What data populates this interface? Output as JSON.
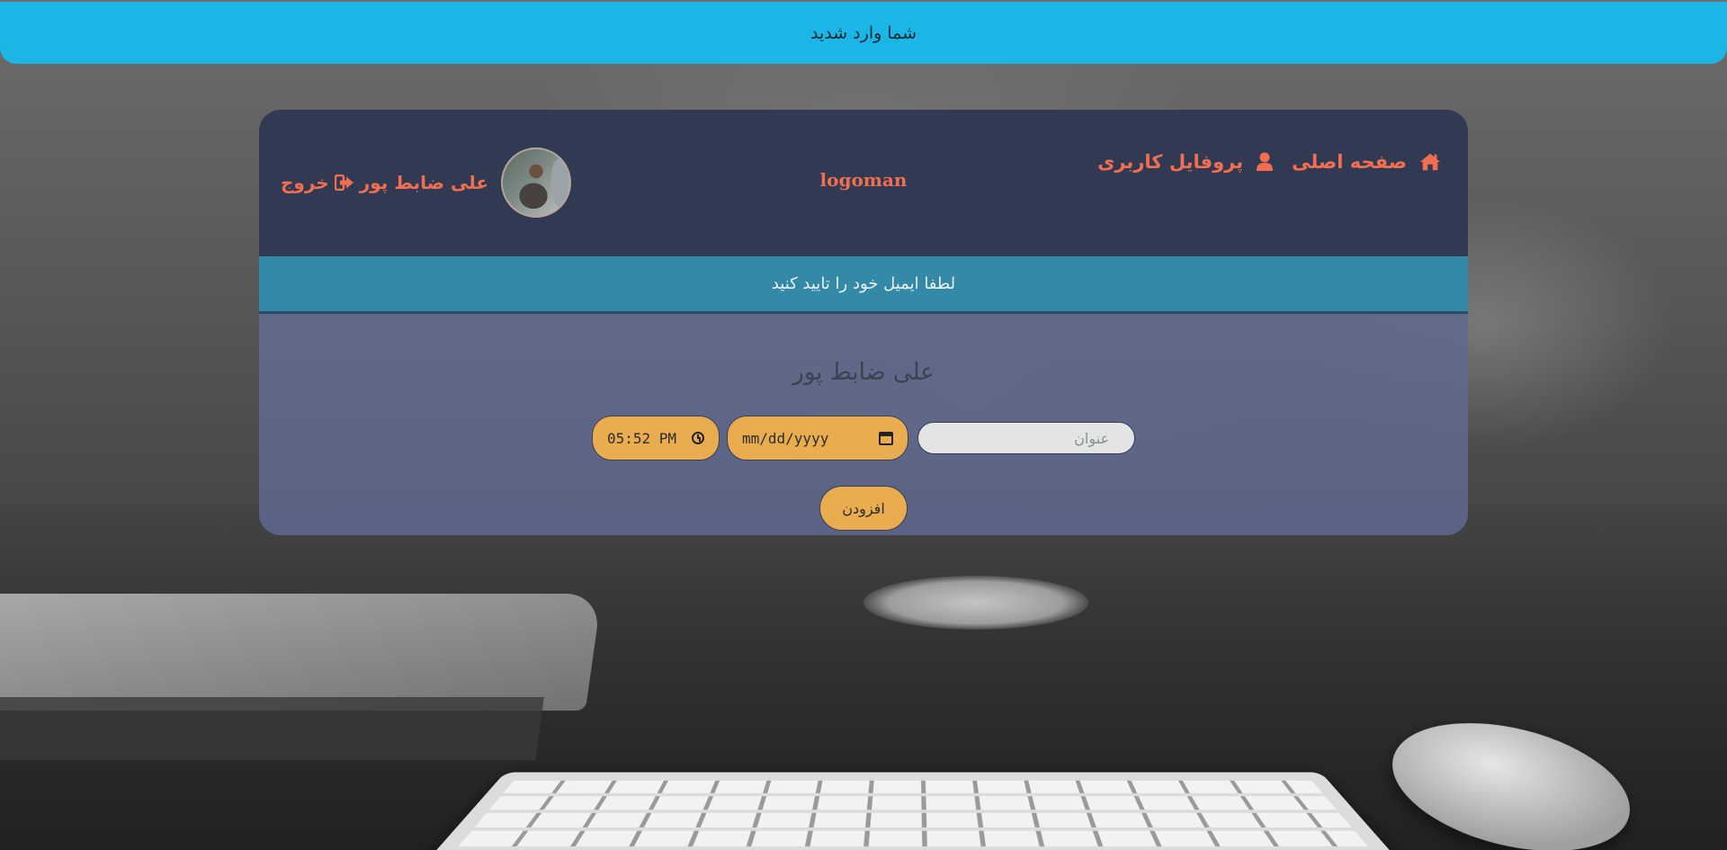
{
  "notification": {
    "text": "شما وارد شدید"
  },
  "navbar": {
    "user_name": "علی ضابط پور",
    "logout_label": "خروج",
    "logo_text": "logoman",
    "profile_label": "پروفایل کاربری",
    "home_label": "صفحه اصلی",
    "icons": {
      "logout": "sign-out-icon",
      "profile": "user-icon",
      "home": "home-icon"
    }
  },
  "email_alert": {
    "text": "لطفا ایمیل خود را تایید کنید"
  },
  "content": {
    "heading": "علی ضابط پور",
    "form": {
      "title_placeholder": "عنوان",
      "date_value": "mm/dd/yyyy",
      "time_value": "05:52 PM",
      "submit_label": "افزودن"
    }
  },
  "colors": {
    "notification_bg": "#1bb5e6",
    "navbar_bg": "#313a52",
    "accent_orange": "#f26e50",
    "email_alert_bg": "#348aa6",
    "input_yellow": "#e9ad4f"
  }
}
